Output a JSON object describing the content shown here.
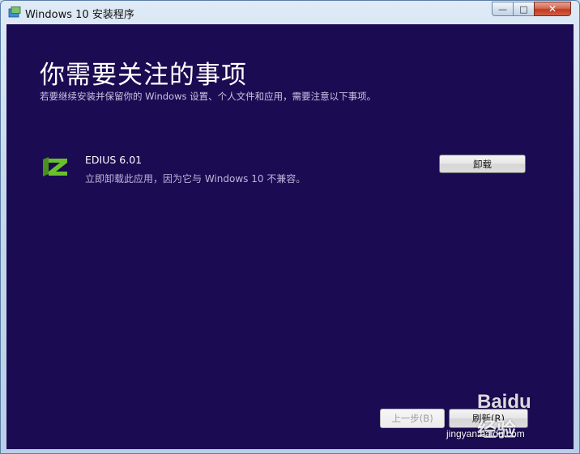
{
  "window": {
    "title": "Windows 10 安装程序",
    "controls": {
      "minimize": "—",
      "maximize": "□",
      "close": "✕"
    }
  },
  "main": {
    "heading": "你需要关注的事项",
    "subheading": "若要继续安装并保留你的 Windows 设置、个人文件和应用，需要注意以下事项。",
    "items": [
      {
        "name": "EDIUS 6.01",
        "description": "立即卸载此应用，因为它与 Windows 10 不兼容。",
        "action_label": "卸载",
        "icon": "edius-logo-icon"
      }
    ]
  },
  "footer": {
    "back_label": "上一步(B)",
    "refresh_label": "刷新(R)"
  },
  "watermark": {
    "logo_text": "Baidu经验",
    "url": "jingyan.baidu.com"
  },
  "colors": {
    "content_bg": "#1b0b52",
    "logo_green": "#6abf2e"
  }
}
